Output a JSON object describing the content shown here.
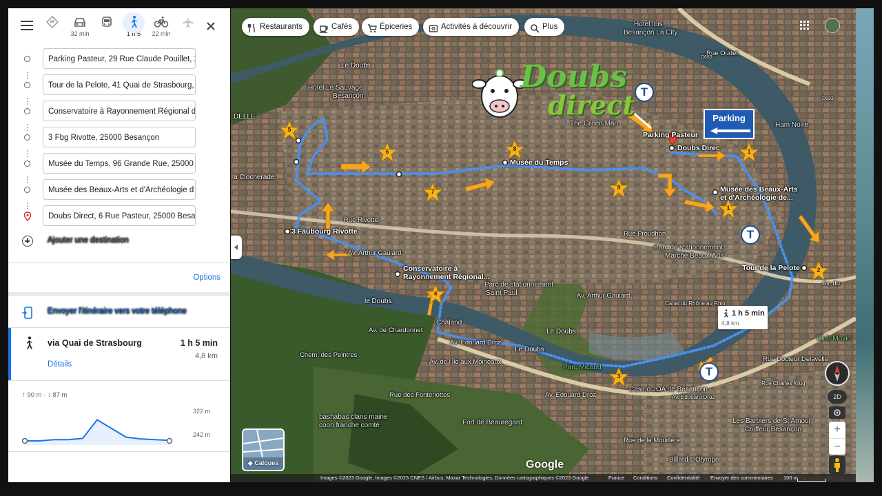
{
  "modes": [
    {
      "name": "directions-icon",
      "time": ""
    },
    {
      "name": "car-icon",
      "time": "32 min"
    },
    {
      "name": "transit-icon",
      "time": ""
    },
    {
      "name": "walk-icon",
      "time": "1 h 5",
      "active": true
    },
    {
      "name": "bike-icon",
      "time": "22 min"
    },
    {
      "name": "plane-icon",
      "time": ""
    }
  ],
  "stops": [
    "Parking Pasteur, 29 Rue Claude Pouillet, 2",
    "Tour de la Pelote, 41 Quai de Strasbourg,",
    "Conservatoire à Rayonnement Régional d",
    "3 Fbg Rivotte, 25000 Besançon",
    "Musée du Temps, 96 Grande Rue, 25000",
    "Musée des Beaux-Arts et d'Archéologie d",
    "Doubs Direct, 6 Rue Pasteur, 25000 Besa"
  ],
  "add_destination": "Ajouter une destination",
  "options": "Options",
  "send_to_phone": "Envoyer l'itinéraire vers votre téléphone",
  "route": {
    "via": "via Quai de Strasbourg",
    "duration": "1 h 5 min",
    "distance": "4,8 km",
    "details": "Détails"
  },
  "elevation": {
    "stats": "↑ 90 m · ↓ 87 m",
    "high": "322 m",
    "low": "242 m",
    "profile": [
      0.0,
      0.0,
      0.05,
      0.05,
      0.1,
      0.85,
      0.5,
      0.15,
      0.08,
      0.05,
      0.02
    ]
  },
  "chips": [
    "Restaurants",
    "Cafés",
    "Épiceries",
    "Activités à découvrir",
    "Plus"
  ],
  "map_labels": {
    "hotel_ibis": "Hotel Ibis",
    "besancon_la_city": "Besançon La City",
    "rue_oudet": "Rue Oudet",
    "d683a": "D683",
    "d683b": "D683",
    "le_doubs_n": "Le Doubs",
    "hotel_sauvage": "Hotel Le Sauvage",
    "besancon": "Besançon",
    "delle": "DELLE",
    "green_man": "The Green Man",
    "parking_pasteur": "Parking Pasteur",
    "doubs_direc": "Doubs Direc",
    "rue_gambetta": "Rue Gambetta",
    "musee_temps": "Musée du Temps",
    "clocherade": "a Clocherade",
    "musee_beaux_arts1": "Musée des Beaux-Arts",
    "musee_beaux_arts2": "et d'Archéologie de...",
    "rue_rivotte": "Rue Rivotte",
    "faubourg_rivotte": "3 Faubourg Rivotte",
    "rue_proudhon": "Rue Proudhon",
    "parc_stat_ba1": "Parc de stationnement",
    "parc_stat_ba2": "Marché Beaux-Arts",
    "av_arthur_gaulard_w": "Av. Arthur Gaulard",
    "conservatoire1": "Conservatoire à",
    "conservatoire2": "Rayonnement Régional...",
    "tour_pelote": "Tour de la Pelote",
    "av_pelote": "Av. du",
    "parc_stat_sp1": "Parc de stationnement",
    "parc_stat_sp2": "Saint Paul",
    "av_arthur_gaulard": "Av. Arthur Gaulard",
    "le_doubs_w": "le Doubs",
    "canal": "Canal du Rhône au Rhin",
    "chaland": "Chaland",
    "av_chardonnet": "Av. de Chardonnet",
    "le_doubs_c": "Le Doubs",
    "le_doubs_s": "Le Doubs",
    "club_moving": "Club Movin",
    "chem_peintres": "Chem. des Peintres",
    "av_ile_moineaux": "Av. de l'Île aux Moineaux",
    "av_edouard_droz1": "Av. Edouard Droz",
    "av_edouard_droz2": "Av. Edouard Droz",
    "parc_micaud": "Parc Micaud",
    "rue_docteur": "Rue Docteur Delavelle",
    "rue_fontenottes": "Rue des Fontenottes",
    "casino": "Casino JOA de Besançon",
    "rue_charles": "Rue Charles Krug",
    "av_droz_e": "Av. Edouard Droz",
    "bashabas1": "bashabas clans maine",
    "bashabas2": "coon franche comté",
    "fort": "Fort de Beauregard",
    "barbiers1": "Les Barbiers de St Amour",
    "barbiers2": "Coiffeur Besançon",
    "rue_mouillere": "Rue de la Mouillère",
    "billard": "Billard L'Olympe",
    "ham_noire": "Ham Noire"
  },
  "stars": [
    "1",
    "2",
    "3",
    "4",
    "5",
    "6",
    "7",
    "8",
    "9",
    "1"
  ],
  "logo": {
    "word1": "Doubs",
    "word2": "direct"
  },
  "parking_sign": "Parking",
  "route_tip": {
    "duration": "1 h 5 min",
    "distance": "4,8 km"
  },
  "layers": "Calques",
  "view_2d": "2D",
  "google": "Google",
  "attribution": [
    "Images ©2023 Google, Images ©2023 CNES / Airbus, Maxar Technologies, Données cartographiques ©2023 Google",
    "France",
    "Conditions",
    "Confidentialité",
    "Envoyer des commentaires"
  ],
  "scale": "100 m",
  "colors": {
    "accent": "#1a73e8",
    "route": "#4a90f0",
    "star": "#f7b21b",
    "arrow": "#f5a623"
  }
}
